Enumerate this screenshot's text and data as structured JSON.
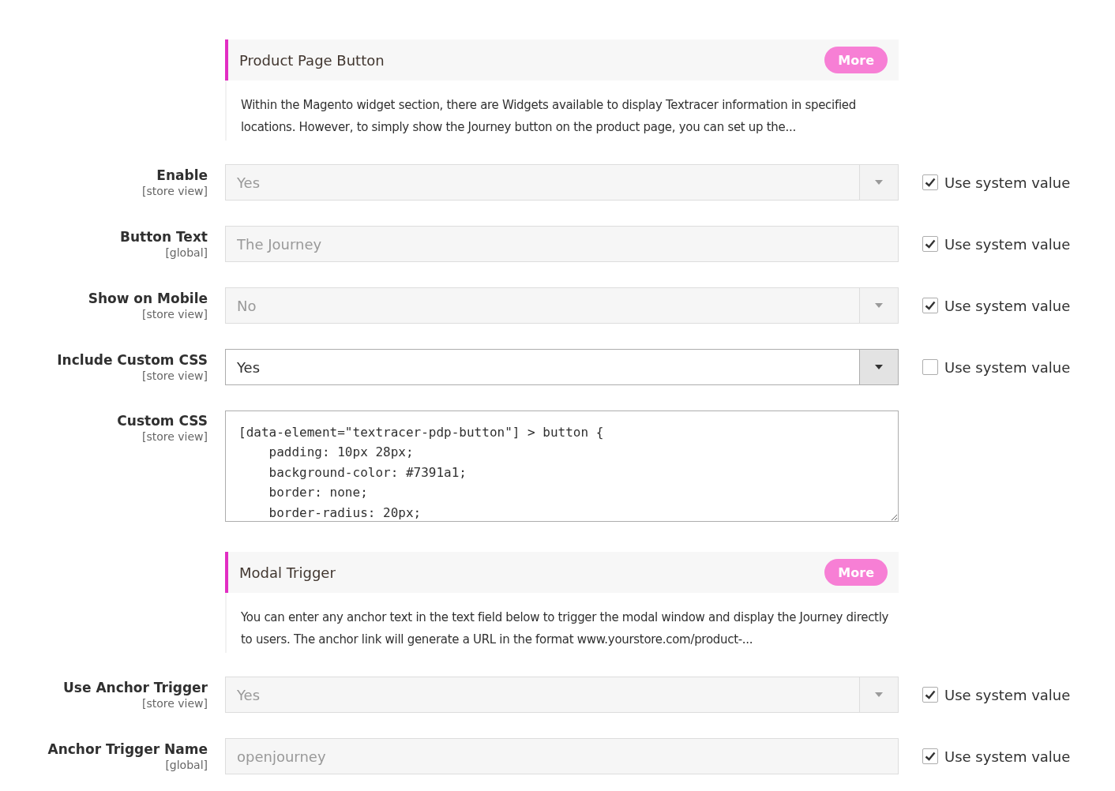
{
  "sections": [
    {
      "title": "Product Page Button",
      "more_button": "More",
      "description": "Within the Magento widget section, there are Widgets available to display Textracer information in specified locations. However, to simply show the Journey button on the product page, you can set up the...",
      "fields": [
        {
          "kind": "select",
          "label": "Enable",
          "scope": "[store view]",
          "value": "Yes",
          "use_system": {
            "label": "Use system value",
            "checked": true
          }
        },
        {
          "kind": "text",
          "label": "Button Text",
          "scope": "[global]",
          "value": "The Journey",
          "use_system": {
            "label": "Use system value",
            "checked": true
          }
        },
        {
          "kind": "select",
          "label": "Show on Mobile",
          "scope": "[store view]",
          "value": "No",
          "use_system": {
            "label": "Use system value",
            "checked": true
          }
        },
        {
          "kind": "select",
          "label": "Include Custom CSS",
          "scope": "[store view]",
          "value": "Yes",
          "use_system": {
            "label": "Use system value",
            "checked": false
          }
        },
        {
          "kind": "textarea",
          "label": "Custom CSS",
          "scope": "[store view]",
          "value": "[data-element=\"textracer-pdp-button\"] > button {\n    padding: 10px 28px;\n    background-color: #7391a1;\n    border: none;\n    border-radius: 20px;"
        }
      ]
    },
    {
      "title": "Modal Trigger",
      "more_button": "More",
      "description": "You can enter any anchor text in the text field below to trigger the modal window and display the Journey directly to users. The anchor link will generate a URL in the format www.yourstore.com/product-...",
      "fields": [
        {
          "kind": "select",
          "label": "Use Anchor Trigger",
          "scope": "[store view]",
          "value": "Yes",
          "use_system": {
            "label": "Use system value",
            "checked": true
          }
        },
        {
          "kind": "text",
          "label": "Anchor Trigger Name",
          "scope": "[global]",
          "value": "openjourney",
          "use_system": {
            "label": "Use system value",
            "checked": true
          }
        }
      ]
    }
  ]
}
